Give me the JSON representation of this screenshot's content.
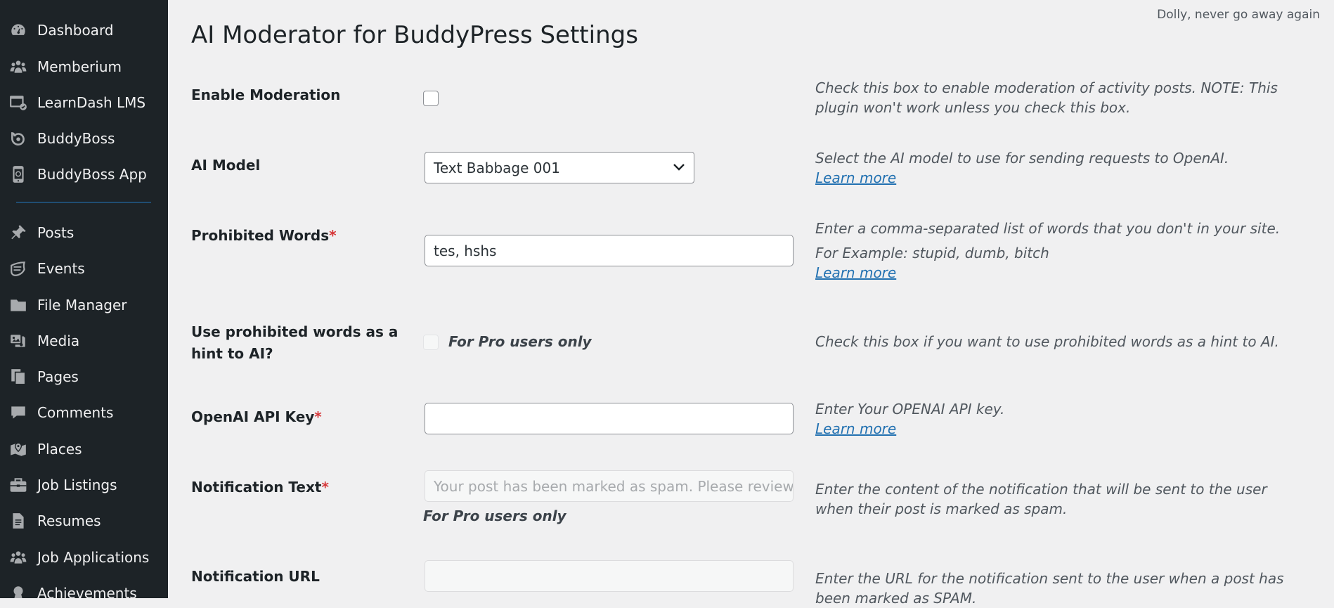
{
  "sidebar": {
    "items": [
      {
        "label": "Dashboard",
        "icon": "dashboard-icon"
      },
      {
        "label": "Memberium",
        "icon": "groups-icon"
      },
      {
        "label": "LearnDash LMS",
        "icon": "learndash-icon"
      },
      {
        "label": "BuddyBoss",
        "icon": "buddyboss-icon"
      },
      {
        "label": "BuddyBoss App",
        "icon": "buddyboss-app-icon"
      },
      {
        "label": "Posts",
        "icon": "pin-icon"
      },
      {
        "label": "Events",
        "icon": "events-icon"
      },
      {
        "label": "File Manager",
        "icon": "folder-icon"
      },
      {
        "label": "Media",
        "icon": "media-icon"
      },
      {
        "label": "Pages",
        "icon": "pages-icon"
      },
      {
        "label": "Comments",
        "icon": "comment-icon"
      },
      {
        "label": "Places",
        "icon": "places-icon"
      },
      {
        "label": "Job Listings",
        "icon": "briefcase-icon"
      },
      {
        "label": "Resumes",
        "icon": "document-icon"
      },
      {
        "label": "Job Applications",
        "icon": "groups-icon"
      },
      {
        "label": "Achievements",
        "icon": "achievements-icon"
      }
    ]
  },
  "header": {
    "top_note": "Dolly, never go away again",
    "title": "AI Moderator for BuddyPress Settings"
  },
  "form": {
    "enable_moderation": {
      "label": "Enable Moderation",
      "desc": "Check this box to enable moderation of activity posts. NOTE: This plugin won't work unless you check this box."
    },
    "ai_model": {
      "label": "AI Model",
      "value": "Text Babbage 001",
      "desc": "Select the AI model to use for sending requests to OpenAI.",
      "link": "Learn more"
    },
    "prohibited_words": {
      "label": "Prohibited Words",
      "required": "*",
      "value": "tes, hshs",
      "desc": "Enter a comma-separated list of words that you don't in your site.",
      "example": "For Example: stupid, dumb, bitch",
      "link": "Learn more"
    },
    "hint": {
      "label": "Use prohibited words as a hint to AI?",
      "pro_note": "For Pro users only",
      "desc": "Check this box if you want to use prohibited words as a hint to AI."
    },
    "api_key": {
      "label": "OpenAI API Key",
      "required": "*",
      "value": "",
      "desc": "Enter Your OPENAI API key.",
      "link": "Learn more"
    },
    "notification_text": {
      "label": "Notification Text",
      "required": "*",
      "placeholder": "Your post has been marked as spam. Please review your post",
      "pro_note": "For Pro users only",
      "desc": "Enter the content of the notification that will be sent to the user when their post is marked as spam."
    },
    "notification_url": {
      "label": "Notification URL",
      "value": "",
      "desc": "Enter the URL for the notification sent to the user when a post has been marked as SPAM."
    }
  }
}
